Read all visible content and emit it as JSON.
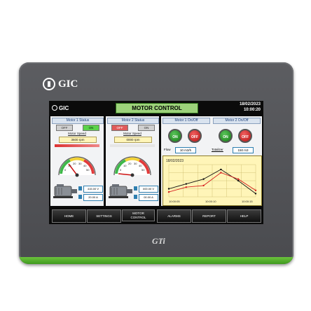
{
  "device": {
    "brand": "GIC",
    "model": "GTi"
  },
  "screen": {
    "logo": "GIC",
    "title": "MOTOR CONTROL",
    "date": "18/02/2023",
    "time": "10:00:20",
    "motor1": {
      "status_label": "Motor 1 Status",
      "off_label": "OFF",
      "on_label": "ON",
      "speed_label": "Motor Speed",
      "speed_value": "3600 rpm",
      "voltage": "415.00 V",
      "current": "20.00 A"
    },
    "motor2": {
      "status_label": "Motor 2 Status",
      "off_label": "OFF",
      "on_label": "ON",
      "speed_label": "Motor Speed",
      "speed_value": "0000 rpm",
      "voltage": "000.00 V",
      "current": "00.00 A"
    },
    "onoff": {
      "m1_label": "Motor 1 On/Off",
      "m2_label": "Motor 2 On/Off",
      "on": "ON",
      "off": "OFF"
    },
    "flow": {
      "label": "Flow",
      "value": "10 m3/h",
      "totalizer_label": "Totalizer",
      "totalizer_value": "150 m3",
      "chart_date": "18/02/2023"
    },
    "gauge_ticks": [
      "0",
      "10",
      "20",
      "30",
      "40",
      "50"
    ],
    "nav": [
      "HOME",
      "SETTINGS",
      "MOTOR CONTROL",
      "ALARMS",
      "REPORT",
      "HELP"
    ]
  },
  "chart_data": {
    "type": "line",
    "x": [
      "10:00:05",
      "10:00:10",
      "10:00:15"
    ],
    "series": [
      {
        "values": [
          0.25,
          0.4,
          0.55,
          0.85,
          0.5,
          0.1
        ],
        "color": "#111111"
      },
      {
        "values": [
          0.15,
          0.3,
          0.35,
          0.75,
          0.55,
          0.2
        ],
        "color": "#d62020"
      }
    ]
  }
}
